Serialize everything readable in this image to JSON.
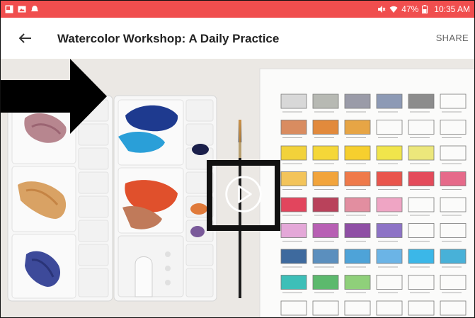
{
  "status_bar": {
    "left_icons": [
      "gallery-notification-icon",
      "image-notification-icon",
      "alert-notification-icon"
    ],
    "right_icons": [
      "mute-icon",
      "wifi-icon",
      "battery-icon"
    ],
    "battery": "47%",
    "time": "10:35 AM",
    "color": "#f04e4e"
  },
  "app_bar": {
    "back_icon": "arrow-back-icon",
    "title": "Watercolor Workshop: A Daily Practice",
    "share_label": "SHARE"
  },
  "video": {
    "thumbnail": "watercolor-palette-and-swatch-chart",
    "play_icon": "play-circle-icon",
    "annotation": "black-arrow-pointing-to-play-button"
  }
}
